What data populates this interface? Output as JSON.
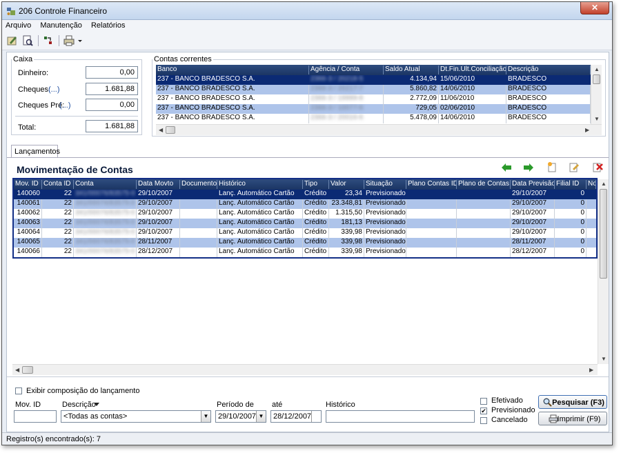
{
  "window": {
    "title": "206 Controle Financeiro",
    "close_label": "✕"
  },
  "menu": [
    "Arquivo",
    "Manutenção",
    "Relatórios"
  ],
  "caixa": {
    "legend": "Caixa",
    "dinheiro_label": "Dinheiro:",
    "dinheiro": "0,00",
    "cheques_label": "Cheques:",
    "cheques_link": "(...)",
    "cheques": "1.681,88",
    "cheques_pre_label": "Cheques Pré:",
    "cheques_pre_link": "(...)",
    "cheques_pre": "0,00",
    "total_label": "Total:",
    "total": "1.681,88"
  },
  "contas": {
    "legend": "Contas correntes",
    "columns": [
      "Banco",
      "Agência / Conta",
      "Saldo Atual",
      "Dt.Fin.Últ.Conciliação",
      "Descrição"
    ],
    "rows": [
      [
        "237 - BANCO BRADESCO S.A.",
        "2366-3 / 20218-5",
        "4.134,94",
        "15/06/2010",
        "BRADESCO"
      ],
      [
        "237 - BANCO BRADESCO S.A.",
        "2366-3 / 20217-7",
        "5.860,82",
        "14/06/2010",
        "BRADESCO"
      ],
      [
        "237 - BANCO BRADESCO S.A.",
        "2366-3 / 19999-8",
        "2.772,09",
        "11/06/2010",
        "BRADESCO"
      ],
      [
        "237 - BANCO BRADESCO S.A.",
        "2366-3 / 10077-6",
        "729,05",
        "02/06/2010",
        "BRADESCO"
      ],
      [
        "237 - BANCO BRADESCO S.A.",
        "2366-3 / 20016-6",
        "5.478,09",
        "14/06/2010",
        "BRADESCO"
      ]
    ]
  },
  "tab_label": "Lançamentos",
  "section_title": "Movimentação de Contas",
  "mov": {
    "columns": [
      "Mov. ID",
      "Conta ID",
      "Conta",
      "Data Movto",
      "Documento",
      "Histórico",
      "Tipo",
      "Valor",
      "Situação",
      "Plano Contas ID",
      "Plano de Contas",
      "Data Previsão",
      "Filial ID",
      "No"
    ],
    "rows": [
      [
        "140060",
        "22",
        "341/00076/83575-0",
        "29/10/2007",
        "",
        "Lanç. Automático Cartão",
        "Crédito",
        "23,34",
        "Previsionado",
        "",
        "",
        "29/10/2007",
        "0"
      ],
      [
        "140061",
        "22",
        "341/00076/83575-0",
        "29/10/2007",
        "",
        "Lanç. Automático Cartão",
        "Crédito",
        "23.348,81",
        "Previsionado",
        "",
        "",
        "29/10/2007",
        "0"
      ],
      [
        "140062",
        "22",
        "341/00076/83575-0",
        "29/10/2007",
        "",
        "Lanç. Automático Cartão",
        "Crédito",
        "1.315,50",
        "Previsionado",
        "",
        "",
        "29/10/2007",
        "0"
      ],
      [
        "140063",
        "22",
        "341/00076/83575-0",
        "29/10/2007",
        "",
        "Lanç. Automático Cartão",
        "Crédito",
        "181,13",
        "Previsionado",
        "",
        "",
        "29/10/2007",
        "0"
      ],
      [
        "140064",
        "22",
        "341/00076/83575-0",
        "29/10/2007",
        "",
        "Lanç. Automático Cartão",
        "Crédito",
        "339,98",
        "Previsionado",
        "",
        "",
        "29/10/2007",
        "0"
      ],
      [
        "140065",
        "22",
        "341/00076/83575-0",
        "28/11/2007",
        "",
        "Lanç. Automático Cartão",
        "Crédito",
        "339,98",
        "Previsionado",
        "",
        "",
        "28/11/2007",
        "0"
      ],
      [
        "140066",
        "22",
        "341/00076/83575-0",
        "28/12/2007",
        "",
        "Lanç. Automático Cartão",
        "Crédito",
        "339,98",
        "Previsionado",
        "",
        "",
        "28/12/2007",
        "0"
      ]
    ]
  },
  "filters": {
    "exibir_label": "Exibir composição do lançamento",
    "mov_id_label": "Mov. ID",
    "mov_id_value": "",
    "descricao_label": "Descrição",
    "descricao_value": "<Todas as contas>",
    "periodo_label": "Período de",
    "periodo_de": "29/10/2007",
    "ate_label": "até",
    "periodo_ate": "28/12/2007",
    "historico_label": "Histórico",
    "historico_value": "",
    "efetivado_label": "Efetivado",
    "efetivado_checked": false,
    "previsionado_label": "Previsionado",
    "previsionado_checked": true,
    "cancelado_label": "Cancelado",
    "cancelado_checked": false,
    "pesquisar_label": "Pesquisar (F3)",
    "imprimir_label": "Imprimir (F9)"
  },
  "status": "Registro(s) encontrado(s): 7",
  "colors": {
    "header": "#1f3a6e",
    "selected_row": "#0b2a74",
    "alt_row": "#aec4ea",
    "grid_border": "#122e86"
  }
}
